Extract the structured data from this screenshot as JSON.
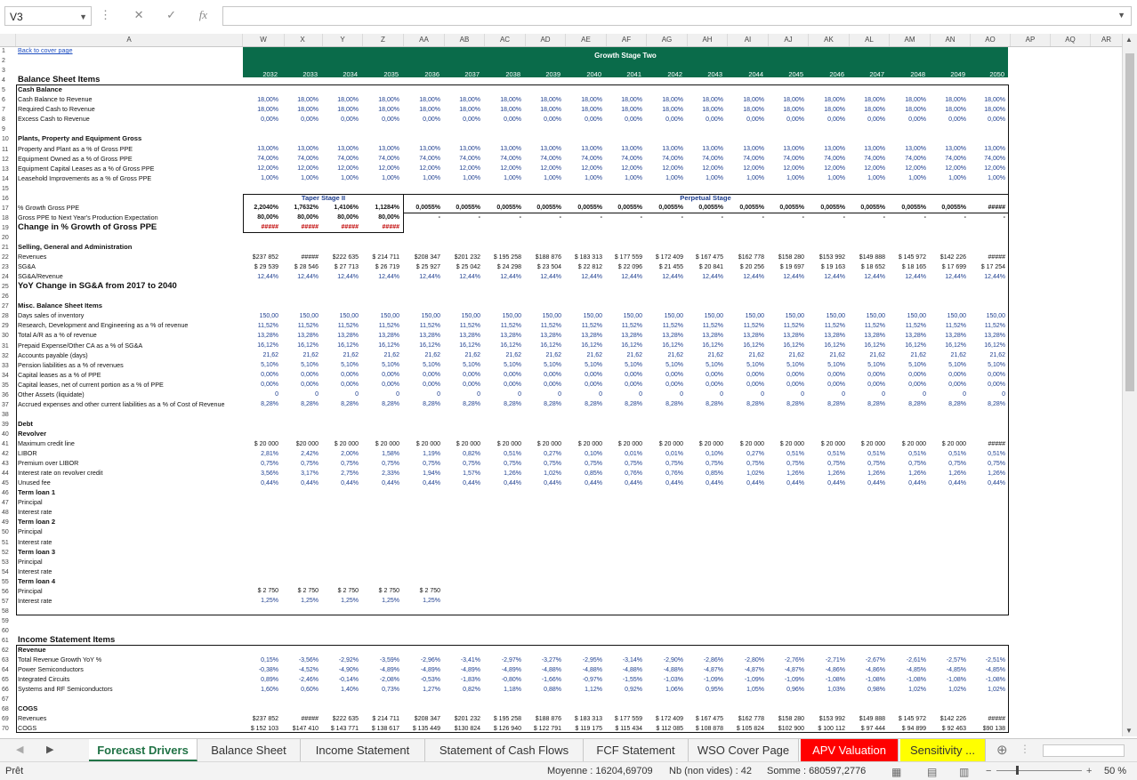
{
  "namebox": "V3",
  "toolbar": {
    "cancel": "✕",
    "confirm": "✓",
    "fx": "fx"
  },
  "col_letters": [
    "A",
    "W",
    "X",
    "Y",
    "Z",
    "AA",
    "AB",
    "AC",
    "AD",
    "AE",
    "AF",
    "AG",
    "AH",
    "AI",
    "AJ",
    "AK",
    "AL",
    "AM",
    "AN",
    "AO",
    "AP",
    "AQ",
    "AR"
  ],
  "band_title": "Growth Stage Two",
  "years": [
    "2032",
    "2033",
    "2034",
    "2035",
    "2036",
    "2037",
    "2038",
    "2039",
    "2040",
    "2041",
    "2042",
    "2043",
    "2044",
    "2045",
    "2046",
    "2047",
    "2048",
    "2049",
    "2050"
  ],
  "labels": {
    "r1": "Back to cover page",
    "r4": "Balance Sheet Items",
    "r5": "Cash Balance",
    "r6": "Cash Balance to Revenue",
    "r7": "Required Cash to Revenue",
    "r8": "Excess Cash to Revenue",
    "r10": "Plants, Property and Equipment Gross",
    "r11": "Property and Plant as a % of Gross PPE",
    "r12": "Equipment Owned as a % of Gross PPE",
    "r13": "Equipment Capital Leases as a % of Gross PPE",
    "r14": "Leasehold Improvements as a % of Gross PPE",
    "r17": "% Growth Gross PPE",
    "r18": "Gross PPE to Next Year's Production Expectation",
    "r19": "Change in % Growth of Gross PPE",
    "r21": "Selling, General and Administration",
    "r22": "Revenues",
    "r23": "SG&A",
    "r24": "SG&A/Revenue",
    "r25": "YoY Change in SG&A from 2017 to 2040",
    "r27": "Misc. Balance Sheet Items",
    "r28": "Days sales of inventory",
    "r29": "Research, Development and Engineering as a % of revenue",
    "r30": "Total A/R as a % of revenue",
    "r31": "Prepaid Expense/Other CA as a % of SG&A",
    "r32": "Accounts payable (days)",
    "r33": "Pension liabilities as a % of revenues",
    "r34": "Capital leases as a % of PPE",
    "r35": "Capital leases, net of current portion as a % of PPE",
    "r36": "Other Assets (liquidate)",
    "r37": "Accrued expenses and other current liabilities as a % of Cost of Revenue",
    "r39": "Debt",
    "r40": "Revolver",
    "r41": "Maximum credit line",
    "r42": "LIBOR",
    "r43": "Premium over LIBOR",
    "r44": "Interest rate on revolver credit",
    "r45": "Unused fee",
    "r46": "Term loan 1",
    "r47": "Principal",
    "r48": "Interest rate",
    "r49": "Term loan 2",
    "r50": "Principal",
    "r51": "Interest rate",
    "r52": "Term loan 3",
    "r53": "Principal",
    "r54": "Interest rate",
    "r55": "Term loan 4",
    "r56": "Principal",
    "r57": "Interest rate",
    "r61": "Income Statement Items",
    "r62": "Revenue",
    "r63": "Total Revenue Growth YoY %",
    "r64": "Power Semiconductors",
    "r65": "Integrated Circuits",
    "r66": "Systems and RF Semiconductors",
    "r68": "COGS",
    "r69": "Revenues",
    "r70": "COGS"
  },
  "stage_labels": {
    "taper": "Taper Stage II",
    "perpetual": "Perpetual Stage"
  },
  "rows": {
    "r6": "18,00%",
    "r7": "18,00%",
    "r8": "0,00%",
    "r11": "13,00%",
    "r12": "74,00%",
    "r13": "12,00%",
    "r14": "1,00%",
    "r17": [
      "2,2040%",
      "1,7632%",
      "1,4106%",
      "1,1284%",
      "0,0055%",
      "0,0055%",
      "0,0055%",
      "0,0055%",
      "0,0055%",
      "0,0055%",
      "0,0055%",
      "0,0055%",
      "0,0055%",
      "0,0055%",
      "0,0055%",
      "0,0055%",
      "0,0055%",
      "0,0055%",
      "#####"
    ],
    "r18": [
      "80,00%",
      "80,00%",
      "80,00%",
      "80,00%",
      "-",
      "-",
      "-",
      "-",
      "-",
      "-",
      "-",
      "-",
      "-",
      "-",
      "-",
      "-",
      "-",
      "-",
      "-"
    ],
    "r19": [
      "#####",
      "#####",
      "#####",
      "#####"
    ],
    "r22": [
      "$237 852",
      "#####",
      "$222 635",
      "$ 214 711",
      "$208 347",
      "$201 232",
      "$ 195 258",
      "$188 876",
      "$ 183 313",
      "$ 177 559",
      "$ 172 409",
      "$ 167 475",
      "$162 778",
      "$158 280",
      "$153 992",
      "$149 888",
      "$ 145 972",
      "$142 226",
      "#####"
    ],
    "r23": [
      "$ 29 539",
      "$ 28 546",
      "$ 27 713",
      "$ 26 719",
      "$ 25 927",
      "$ 25 042",
      "$ 24 298",
      "$ 23 504",
      "$ 22 812",
      "$ 22 096",
      "$ 21 455",
      "$ 20 841",
      "$ 20 256",
      "$ 19 697",
      "$ 19 163",
      "$ 18 652",
      "$ 18 165",
      "$ 17 699",
      "$ 17 254"
    ],
    "r24": "12,44%",
    "r28": "150,00",
    "r29": "11,52%",
    "r30": "13,28%",
    "r31": "16,12%",
    "r32": "21,62",
    "r33": "5,10%",
    "r34": "0,00%",
    "r35": "0,00%",
    "r36": "0",
    "r37": "8,28%",
    "r41": [
      "$ 20 000",
      "$20 000",
      "$ 20 000",
      "$ 20 000",
      "$ 20 000",
      "$ 20 000",
      "$ 20 000",
      "$ 20 000",
      "$ 20 000",
      "$ 20 000",
      "$ 20 000",
      "$ 20 000",
      "$ 20 000",
      "$ 20 000",
      "$ 20 000",
      "$ 20 000",
      "$ 20 000",
      "$ 20 000",
      "#####"
    ],
    "r42": [
      "2,81%",
      "2,42%",
      "2,00%",
      "1,58%",
      "1,19%",
      "0,82%",
      "0,51%",
      "0,27%",
      "0,10%",
      "0,01%",
      "0,01%",
      "0,10%",
      "0,27%",
      "0,51%",
      "0,51%",
      "0,51%",
      "0,51%",
      "0,51%",
      "0,51%"
    ],
    "r43": "0,75%",
    "r44": [
      "3,56%",
      "3,17%",
      "2,75%",
      "2,33%",
      "1,94%",
      "1,57%",
      "1,26%",
      "1,02%",
      "0,85%",
      "0,76%",
      "0,76%",
      "0,85%",
      "1,02%",
      "1,26%",
      "1,26%",
      "1,26%",
      "1,26%",
      "1,26%",
      "1,26%"
    ],
    "r45": "0,44%",
    "r56": [
      "$ 2 750",
      "$ 2 750",
      "$ 2 750",
      "$ 2 750",
      "$ 2 750"
    ],
    "r57": [
      "1,25%",
      "1,25%",
      "1,25%",
      "1,25%",
      "1,25%"
    ],
    "r63": [
      "0,15%",
      "-3,56%",
      "-2,92%",
      "-3,59%",
      "-2,96%",
      "-3,41%",
      "-2,97%",
      "-3,27%",
      "-2,95%",
      "-3,14%",
      "-2,90%",
      "-2,86%",
      "-2,80%",
      "-2,76%",
      "-2,71%",
      "-2,67%",
      "-2,61%",
      "-2,57%",
      "-2,51%"
    ],
    "r64": [
      "-0,38%",
      "-4,52%",
      "-4,90%",
      "-4,89%",
      "-4,89%",
      "-4,89%",
      "-4,89%",
      "-4,88%",
      "-4,88%",
      "-4,88%",
      "-4,88%",
      "-4,87%",
      "-4,87%",
      "-4,87%",
      "-4,86%",
      "-4,86%",
      "-4,85%",
      "-4,85%",
      "-4,85%"
    ],
    "r65": [
      "0,89%",
      "-2,46%",
      "-0,14%",
      "-2,08%",
      "-0,53%",
      "-1,83%",
      "-0,80%",
      "-1,66%",
      "-0,97%",
      "-1,55%",
      "-1,03%",
      "-1,09%",
      "-1,09%",
      "-1,09%",
      "-1,08%",
      "-1,08%",
      "-1,08%",
      "-1,08%",
      "-1,08%"
    ],
    "r66": [
      "1,60%",
      "0,60%",
      "1,40%",
      "0,73%",
      "1,27%",
      "0,82%",
      "1,18%",
      "0,88%",
      "1,12%",
      "0,92%",
      "1,06%",
      "0,95%",
      "1,05%",
      "0,96%",
      "1,03%",
      "0,98%",
      "1,02%",
      "1,02%",
      "1,02%"
    ],
    "r69": [
      "$237 852",
      "#####",
      "$222 635",
      "$ 214 711",
      "$208 347",
      "$201 232",
      "$ 195 258",
      "$188 876",
      "$ 183 313",
      "$ 177 559",
      "$ 172 409",
      "$ 167 475",
      "$162 778",
      "$158 280",
      "$153 992",
      "$149 888",
      "$ 145 972",
      "$142 226",
      "#####"
    ],
    "r70": [
      "$ 152 103",
      "$147 410",
      "$ 143 771",
      "$ 138 617",
      "$ 135 449",
      "$130 824",
      "$ 126 940",
      "$ 122 791",
      "$ 119 175",
      "$ 115 434",
      "$ 112 085",
      "$ 108 878",
      "$ 105 824",
      "$102 900",
      "$ 100 112",
      "$ 97 444",
      "$ 94 899",
      "$ 92 463",
      "$90 138"
    ]
  },
  "tabs": [
    "Forecast Drivers",
    "Balance Sheet",
    "Income Statement",
    "Statement of Cash Flows",
    "FCF Statement",
    "WSO Cover Page",
    "APV Valuation",
    "Sensitivity ..."
  ],
  "status": {
    "ready": "Prêt",
    "average": "Moyenne : 16204,69709",
    "count": "Nb (non vides) : 42",
    "sum": "Somme : 680597,2776",
    "zoom": "50 %"
  },
  "colors": {
    "accent": "#217346",
    "band": "#0a6b4a",
    "value_blue": "#1f3f8f",
    "red_tab": "#ff0000",
    "yellow_tab": "#ffff00"
  }
}
